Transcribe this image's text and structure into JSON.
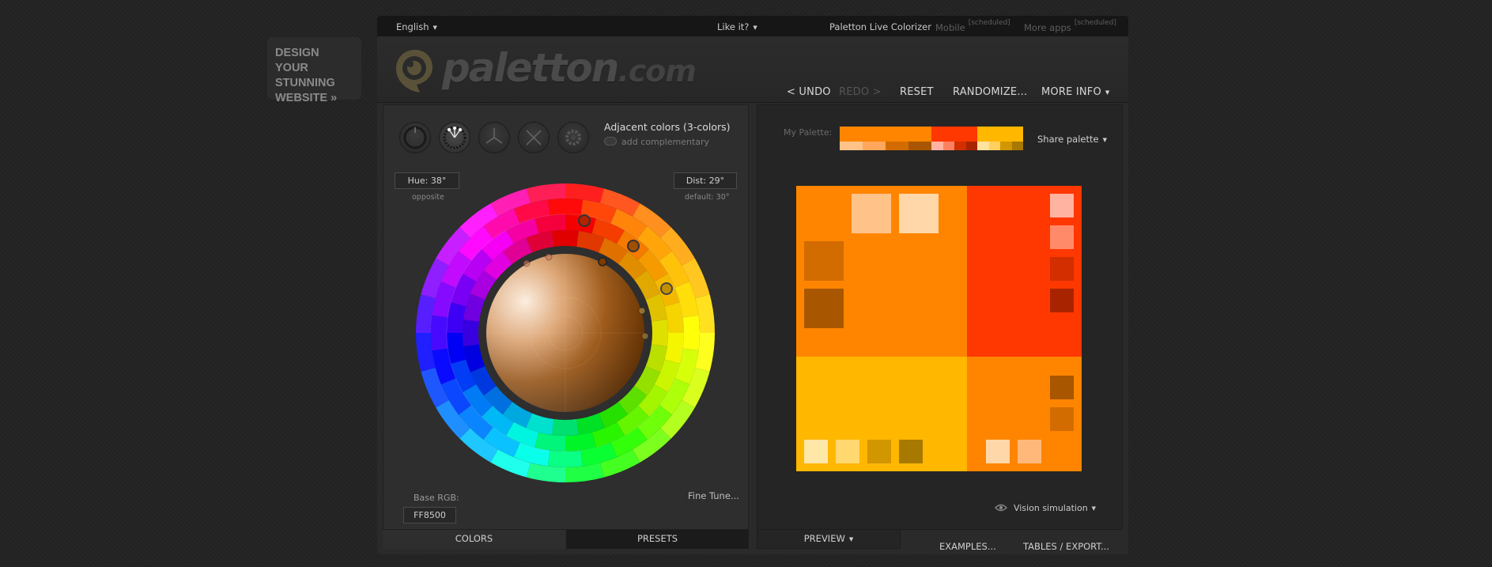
{
  "promo": {
    "line1": "DESIGN YOUR",
    "line2": "STUNNING",
    "line3": "WEBSITE »"
  },
  "topbar": {
    "language": "English",
    "like_it": "Like it?",
    "live_colorizer": "Paletton Live Colorizer",
    "mobile": "Mobile",
    "more_apps": "More apps",
    "scheduled": "[scheduled]"
  },
  "logo": {
    "name": "paletton",
    "tld": ".com"
  },
  "menu": {
    "undo": "< UNDO",
    "redo": "REDO >",
    "reset": "RESET",
    "randomize": "RANDOMIZE...",
    "more_info": "MORE INFO"
  },
  "scheme": {
    "icons": [
      "mono-scheme-icon",
      "adjacent-scheme-icon",
      "triad-scheme-icon",
      "tetrad-scheme-icon",
      "free-style-icon"
    ],
    "title": "Adjacent colors (3-colors)",
    "add_complementary": "add complementary"
  },
  "hue": {
    "label": "Hue: 38°",
    "note": "opposite"
  },
  "dist": {
    "label": "Dist: 29°",
    "note": "default: 30°"
  },
  "base_rgb": {
    "label": "Base RGB:",
    "value": "FF8500"
  },
  "fine_tune": "Fine Tune...",
  "left_tabs": {
    "colors": "COLORS",
    "presets": "PRESETS"
  },
  "palette": {
    "label": "My Palette:",
    "share": "Share palette",
    "primary": "#FF8500",
    "secondary1": "#FF3700",
    "secondary2": "#FFB700",
    "groups": [
      {
        "main": "#FF8500",
        "shades": [
          "#FFC38A",
          "#FFA75A",
          "#D26C00",
          "#A85700"
        ]
      },
      {
        "main": "#FF3700",
        "shades": [
          "#FFB3A0",
          "#FF8060",
          "#D22E00",
          "#A82400"
        ]
      },
      {
        "main": "#FFB700",
        "shades": [
          "#FFE39C",
          "#FFD05C",
          "#D29600",
          "#A87900"
        ]
      }
    ]
  },
  "preview_swatches": {
    "tl": [
      "#FFC38A",
      "#FFD7A8",
      "#D26C00",
      "#A85700"
    ],
    "tr": [
      "#FFB3A0",
      "#FF8A6A",
      "#D22E00",
      "#A82400"
    ],
    "bl": [
      "#FFE7A8",
      "#FFD870",
      "#D29600",
      "#A87900"
    ],
    "br": [
      "#A85700",
      "#D26C00",
      "#FFD7A8",
      "#FFB87A"
    ]
  },
  "vision": "Vision simulation",
  "bottom_tabs": {
    "preview": "PREVIEW",
    "examples": "EXAMPLES...",
    "tables": "TABLES / EXPORT..."
  }
}
